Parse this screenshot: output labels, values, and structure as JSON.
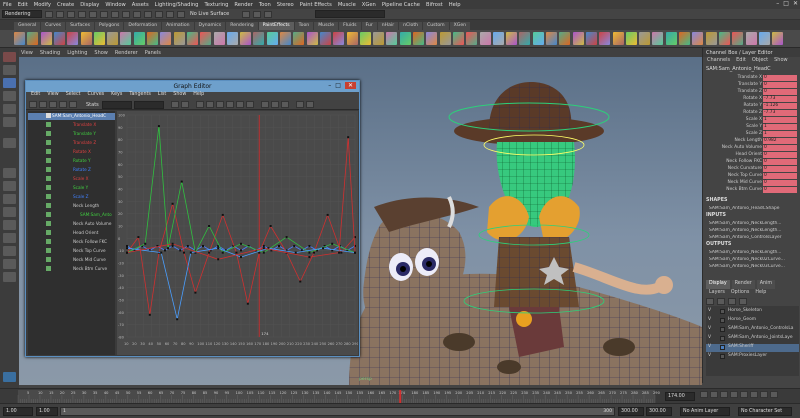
{
  "menubar": {
    "items": [
      "File",
      "Edit",
      "Modify",
      "Create",
      "Display",
      "Window",
      "Assets",
      "Lighting/Shading",
      "Texturing",
      "Render",
      "Toon",
      "Stereo",
      "Paint Effects",
      "Muscle",
      "XGen",
      "Pipeline Cache",
      "Bifrost",
      "Help"
    ]
  },
  "statusline": {
    "mode_dropdown": "Rendering",
    "live_surface": "No Live Surface"
  },
  "shelf": {
    "tabs": [
      "General",
      "Curves",
      "Surfaces",
      "Polygons",
      "Deformation",
      "Animation",
      "Dynamics",
      "Rendering",
      "PaintEffects",
      "Toon",
      "Muscle",
      "Fluids",
      "Fur",
      "nHair",
      "nCloth",
      "Custom",
      "XGen"
    ],
    "active_tab": "PaintEffects"
  },
  "panel_menu": [
    "View",
    "Shading",
    "Lighting",
    "Show",
    "Renderer",
    "Panels"
  ],
  "graph_editor": {
    "title": "Graph Editor",
    "menu": [
      "Edit",
      "View",
      "Select",
      "Curves",
      "Keys",
      "Tangents",
      "List",
      "Show",
      "Help"
    ],
    "stats_label": "Stats",
    "outliner_rows": [
      {
        "label": "SAM:Sam_Antonio_HeadC",
        "color": "#ffffff"
      },
      {
        "label": "Translate X",
        "color": "#e04040"
      },
      {
        "label": "Translate Y",
        "color": "#40d040"
      },
      {
        "label": "Translate Z",
        "color": "#e04040"
      },
      {
        "label": "Rotate X",
        "color": "#e04040"
      },
      {
        "label": "Rotate Y",
        "color": "#40d040"
      },
      {
        "label": "Rotate Z",
        "color": "#4080ff"
      },
      {
        "label": "Scale X",
        "color": "#e04040"
      },
      {
        "label": "Scale Y",
        "color": "#40d040"
      },
      {
        "label": "Scale Z",
        "color": "#4080ff"
      },
      {
        "label": "Neck Length",
        "color": "#cccccc"
      },
      {
        "label": "SAM:Sam_Anto",
        "color": "#40d040"
      },
      {
        "label": "Neck Auto Volume",
        "color": "#cccccc"
      },
      {
        "label": "Head Orient",
        "color": "#cccccc"
      },
      {
        "label": "Neck Follow FKC",
        "color": "#cccccc"
      },
      {
        "label": "Neck Top Curve",
        "color": "#cccccc"
      },
      {
        "label": "Neck Mid Curve",
        "color": "#cccccc"
      },
      {
        "label": "Neck Btm Curve",
        "color": "#cccccc"
      }
    ],
    "y_ticks": [
      "100",
      "90",
      "80",
      "70",
      "60",
      "50",
      "40",
      "30",
      "20",
      "10",
      "0",
      "-10",
      "-20",
      "-30",
      "-40",
      "-50",
      "-60",
      "-70",
      "-80"
    ],
    "x_ticks": [
      "10",
      "20",
      "30",
      "40",
      "50",
      "60",
      "70",
      "80",
      "90",
      "100",
      "110",
      "120",
      "130",
      "140",
      "150",
      "160",
      "170",
      "180",
      "190",
      "200",
      "210",
      "220",
      "230",
      "240",
      "250",
      "260",
      "270",
      "280",
      "290"
    ],
    "current_frame_marker": "174"
  },
  "channel_box": {
    "title": "Channel Box / Layer Editor",
    "menu": [
      "Channels",
      "Edit",
      "Object",
      "Show"
    ],
    "node": "SAM:Sam_Antonio_HeadC",
    "attributes": [
      {
        "name": "Translate X",
        "value": "0"
      },
      {
        "name": "Translate Y",
        "value": "0"
      },
      {
        "name": "Translate Z",
        "value": "0"
      },
      {
        "name": "Rotate X",
        "value": "-7.73"
      },
      {
        "name": "Rotate Y",
        "value": "-1.126"
      },
      {
        "name": "Rotate Z",
        "value": "-7.73"
      },
      {
        "name": "Scale X",
        "value": "1"
      },
      {
        "name": "Scale Y",
        "value": "1"
      },
      {
        "name": "Scale Z",
        "value": "1"
      },
      {
        "name": "Neck Length",
        "value": "0.982"
      },
      {
        "name": "Neck Auto Volume",
        "value": "0"
      },
      {
        "name": "Head Orient",
        "value": "0"
      },
      {
        "name": "Neck Follow FKC",
        "value": "0"
      },
      {
        "name": "Neck Curvature",
        "value": "0"
      },
      {
        "name": "Neck Top Curve",
        "value": "0"
      },
      {
        "name": "Neck Mid Curve",
        "value": "0"
      },
      {
        "name": "Neck Btm Curve",
        "value": "0"
      }
    ],
    "shapes_label": "SHAPES",
    "shapes": [
      "SAM:Sam_Antonio_HeadCShape"
    ],
    "inputs_label": "INPUTS",
    "inputs": [
      "SAM:Sam_Antonio_NeckLength...",
      "SAM:Sam_Antonio_NeckLength...",
      "SAM:Sam_Antonio_ControlsLayer"
    ],
    "outputs_label": "OUTPUTS",
    "outputs": [
      "SAM:Sam_Antonio_NeckLength...",
      "SAM:Sam_Antonio_Neck02Curve...",
      "SAM:Sam_Antonio_Neck03Curve..."
    ]
  },
  "layer_editor": {
    "tabs": [
      "Display",
      "Render",
      "Anim"
    ],
    "active_tab": "Display",
    "menu": [
      "Layers",
      "Options",
      "Help"
    ],
    "layers": [
      {
        "vis": "V",
        "name": "Horse_Skeleton",
        "color": "#555555"
      },
      {
        "vis": "V",
        "name": "Horse_Geom",
        "color": "#555555"
      },
      {
        "vis": "V",
        "name": "SAM:Sam_Antonio_ControlsLa",
        "color": "#555555"
      },
      {
        "vis": "V",
        "name": "SAM:Sam_Antonio_JointsLaye",
        "color": "#555555"
      },
      {
        "vis": "V",
        "name": "SAM:Sheriff",
        "color": "#4a7fc0"
      },
      {
        "vis": "V",
        "name": "SAM:ProxiesLayer",
        "color": "#555555"
      }
    ]
  },
  "timeline": {
    "ticks": [
      "5",
      "10",
      "15",
      "20",
      "25",
      "30",
      "35",
      "40",
      "45",
      "50",
      "55",
      "60",
      "65",
      "70",
      "75",
      "80",
      "85",
      "90",
      "95",
      "100",
      "105",
      "110",
      "115",
      "120",
      "125",
      "130",
      "135",
      "140",
      "145",
      "150",
      "155",
      "160",
      "165",
      "170",
      "174",
      "180",
      "185",
      "190",
      "195",
      "200",
      "205",
      "210",
      "215",
      "220",
      "225",
      "230",
      "235",
      "240",
      "245",
      "250",
      "255",
      "260",
      "265",
      "270",
      "275",
      "280",
      "285",
      "290"
    ],
    "current_frame": "174.00"
  },
  "range": {
    "start": "1.00",
    "inner_start": "1.00",
    "range_label": "1",
    "range_end_label": "300",
    "inner_end": "300.00",
    "end": "300.00",
    "anim_layer": "No Anim Layer",
    "char_set": "No Character Set"
  },
  "colors": {
    "accent": "#6ea0cc",
    "attr_keyed": "#e06a78",
    "viewport_top": "#5a6f87"
  }
}
